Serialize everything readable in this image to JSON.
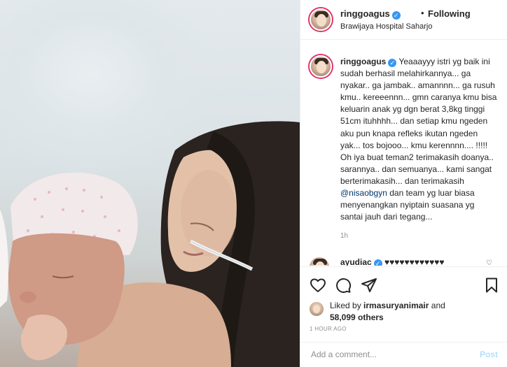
{
  "header": {
    "username": "ringgoagus",
    "follow_status": "Following",
    "location": "Brawijaya Hospital Saharjo"
  },
  "caption": {
    "username": "ringgoagus",
    "text_before_mention": "Yeaaayyy istri yg baik ini sudah berhasil melahirkannya... ga nyakar.. ga jambak.. amannnn... ga rusuh kmu.. kereeennn... gmn caranya kmu bisa keluarin anak yg dgn berat 3,8kg tinggi 51cm ituhhhh... dan setiap kmu ngeden aku pun knapa refleks ikutan ngeden yak... tos bojooo... kmu kerennnn.... !!!!! Oh iya buat teman2 terimakasih doanya.. sarannya.. dan semuanya... kami sangat berterimakasih... dan terimakasih",
    "mention": "@nisaobgyn",
    "text_after_mention": "dan team yg luar biasa menyenangkan nyiptain suasana yg santai jauh dari tegang...",
    "time": "1h"
  },
  "comment": {
    "username": "ayudiac",
    "text": "♥♥♥♥♥♥♥♥♥♥♥♥"
  },
  "likes": {
    "prefix": "Liked by",
    "liker": "irmasuryanimair",
    "conjunction": "and",
    "count": "58,099 others"
  },
  "posted_time": "1 HOUR AGO",
  "add_comment": {
    "placeholder": "Add a comment...",
    "post_label": "Post"
  },
  "icons": {
    "like": "heart-icon",
    "comment": "comment-icon",
    "share": "paper-plane-icon",
    "save": "bookmark-icon",
    "verified": "verified-badge-icon"
  },
  "colors": {
    "verified": "#3897f0",
    "mention": "#00376b",
    "post_disabled": "#b2dffc",
    "story_ring": "#e1306c",
    "muted": "#8e8e8e"
  }
}
